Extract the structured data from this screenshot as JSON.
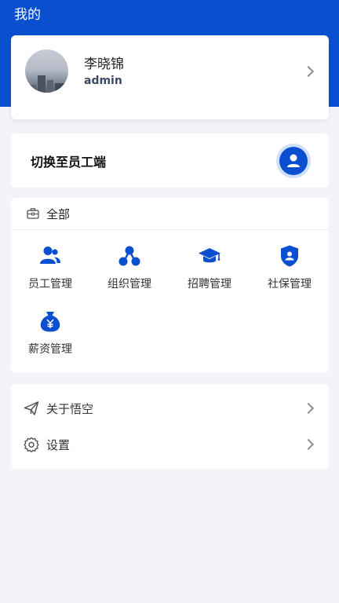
{
  "header": {
    "title": "我的"
  },
  "profile": {
    "name": "李晓锦",
    "username": "admin"
  },
  "switch": {
    "label": "切换至员工端"
  },
  "apps": {
    "section_title": "全部",
    "items": [
      {
        "label": "员工管理",
        "icon": "people-icon"
      },
      {
        "label": "组织管理",
        "icon": "org-icon"
      },
      {
        "label": "招聘管理",
        "icon": "graduation-cap-icon"
      },
      {
        "label": "社保管理",
        "icon": "shield-user-icon"
      },
      {
        "label": "薪资管理",
        "icon": "money-bag-icon"
      }
    ]
  },
  "menu": {
    "items": [
      {
        "label": "关于悟空",
        "icon": "paper-plane-icon"
      },
      {
        "label": "设置",
        "icon": "gear-icon"
      }
    ]
  },
  "colors": {
    "primary": "#0a4fd0",
    "background": "#f2f4f9"
  }
}
